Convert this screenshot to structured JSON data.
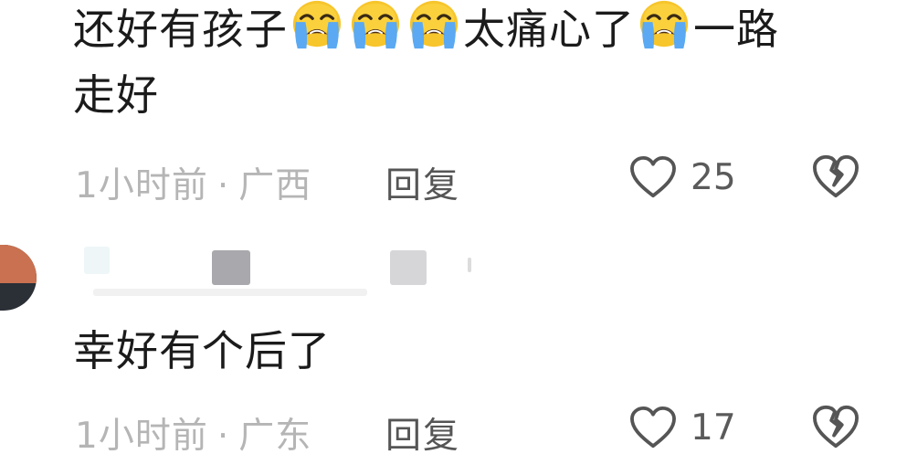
{
  "comments": [
    {
      "text_parts": [
        "还好有孩子",
        "",
        "",
        "",
        "太痛心了",
        "",
        "一路",
        "走好"
      ],
      "time": "1小时前",
      "separator": "·",
      "location": "广西",
      "reply_label": "回复",
      "likes": "25"
    },
    {
      "text": "幸好有个后了",
      "time": "1小时前",
      "separator": "·",
      "location": "广东",
      "reply_label": "回复",
      "likes": "17"
    }
  ],
  "icons": {
    "emoji": "loudly-crying-face-emoji",
    "like": "heart-outline-icon",
    "dislike": "broken-heart-outline-icon"
  },
  "colors": {
    "text": "#1b1b1b",
    "meta": "#b5b5b5",
    "reply": "#555555",
    "icon": "#555555",
    "emoji_face": "#f7c52c",
    "emoji_tears": "#5aa9f2"
  }
}
